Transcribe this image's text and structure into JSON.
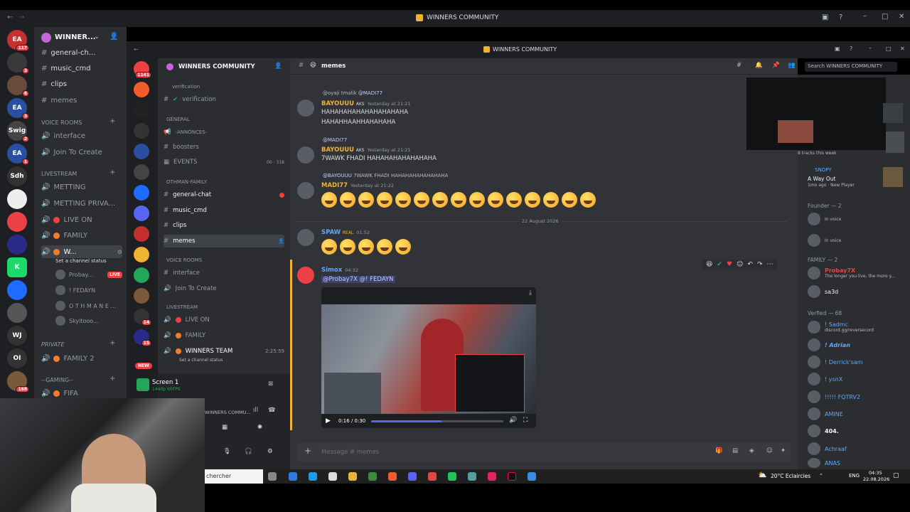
{
  "outer": {
    "title": "WINNERS COMMUNITY",
    "server_name": "WINNER...",
    "servers": [
      {
        "label": "EA",
        "badge": "117"
      },
      {
        "label": "",
        "badge": "3"
      },
      {
        "label": "",
        "badge": "6"
      },
      {
        "label": "EA",
        "badge": "3"
      },
      {
        "label": "Swig",
        "badge": "2"
      },
      {
        "label": "EA",
        "badge": "1"
      },
      {
        "label": "Sdh",
        "badge": ""
      },
      {
        "label": "",
        "badge": ""
      },
      {
        "label": "",
        "badge": ""
      },
      {
        "label": "",
        "badge": ""
      },
      {
        "label": "K",
        "badge": ""
      },
      {
        "label": "",
        "badge": ""
      },
      {
        "label": "",
        "badge": ""
      },
      {
        "label": "WJ",
        "badge": ""
      },
      {
        "label": "OI",
        "badge": ""
      },
      {
        "label": "",
        "badge": "168"
      }
    ],
    "channels_top": [
      "general-ch...",
      "music_cmd",
      "clips",
      "memes"
    ],
    "voice_section": "VOICE ROOMS",
    "voice_channels": [
      "interface",
      "Join To Create"
    ],
    "livestream_section": "LIVESTREAM",
    "live_channels": [
      "METTING",
      "METTING PRIVA...",
      "LIVE ON",
      "FAMILY",
      "W..."
    ],
    "status_hint": "Set a channel status",
    "voice_users": [
      "Probay...",
      "! FEDAYN",
      "O T H M A N E ...",
      "Skyitooo..."
    ],
    "live_badge": "LIVE",
    "private_section": "PRIVATE",
    "private_channels": [
      "FAMILY 2"
    ],
    "gaming_section": "--GAMING--",
    "gaming_channels": [
      "FIFA"
    ]
  },
  "inner": {
    "title": "WINNERS COMMUNITY",
    "server_name": "WINNERS COMMUNITY",
    "verification_section": "verification",
    "verification_channel": "verification",
    "general_section": "GÉNÉRAL",
    "general_channels": [
      "-ANNONCES-",
      "boosters",
      "EVENTS"
    ],
    "events_count": "00 : 318",
    "family_section": "OTHMAN-FAMILY",
    "family_channels": [
      "general-chat",
      "music_cmd",
      "clips",
      "memes"
    ],
    "voice_section": "VOICE ROOMS",
    "voice_channels": [
      "interface",
      "Join To Create"
    ],
    "livestream_section": "LIVESTREAM",
    "live_channels": [
      "LIVE ON",
      "FAMILY",
      "WINNERS TEAM"
    ],
    "live_timer": "2:25:59",
    "status_hint": "Set a channel status",
    "screen_title": "Screen 1",
    "screen_sub": "1440p 60FPS",
    "screen_server": "WINNERS COMMU...",
    "new_badge": "NEW",
    "server_badges": [
      "1141",
      "",
      "",
      "",
      "",
      "",
      "",
      "",
      "",
      "",
      "",
      "",
      "14",
      "15"
    ]
  },
  "chat": {
    "channel": "memes",
    "search_placeholder": "Search WINNERS COMMUNITY",
    "date_divider": "22 August 2026",
    "messages": [
      {
        "reply": "@oyaji tmalik",
        "reply_to": "@MADI77",
        "author": "BAYOUUU",
        "tag": "AKS",
        "time": "Yesterday at 21:21",
        "lines": [
          "HAHAHAHAHAHAHAHAHAHA",
          "HAHAHHAAHHAHAHAHA"
        ]
      },
      {
        "reply": "@MADI77",
        "author": "BAYOUUU",
        "tag": "AKS",
        "time": "Yesterday at 21:21",
        "lines": [
          "7WAWK FHADI HAHAHAHAHAHAHAHA"
        ]
      },
      {
        "reply": "@BAYOUUU",
        "reply_text": "7WAWK FHADI HAHAHAHAHAHAHAHA",
        "author": "MADI77",
        "time": "Yesterday at 21:22",
        "emojis": 15
      },
      {
        "author": "SPAW",
        "tag": "REAL",
        "time": "01:52",
        "emojis": 5
      },
      {
        "author": "Simox",
        "time": "04:32",
        "mentions": "@Probay7X @! FEDAYN",
        "video_time": "0:16 / 0:30",
        "video_progress": 0.53
      }
    ],
    "composer_placeholder": "Message # memes"
  },
  "members": {
    "stream_caption": "8 tracks this week",
    "activity_user": "SNOPY",
    "activity_game": "A Way Out",
    "activity_meta": "1mo ago · New Player",
    "founder_section": "Founder — 2",
    "founder_status": "In voice",
    "family_section": "FAMILY — 2",
    "family": [
      {
        "name": "Probay7X",
        "status": "The longer you live, the more y..."
      },
      {
        "name": "sa3d",
        "status": ""
      }
    ],
    "verified_section": "Verfied — 68",
    "verified": [
      {
        "name": "! Sadmc",
        "status": "discord.gg/reversecord"
      },
      {
        "name": "! Adrian",
        "status": ""
      },
      {
        "name": "! Derrick'sam",
        "status": ""
      },
      {
        "name": "! ysnX",
        "status": ""
      },
      {
        "name": "!!!!! FQTRV2",
        "status": ""
      },
      {
        "name": "AMINE",
        "status": ""
      },
      {
        "name": "404.",
        "status": ""
      },
      {
        "name": "Achraaf",
        "status": ""
      },
      {
        "name": "ANAS",
        "status": ""
      }
    ]
  },
  "taskbar": {
    "search": "chercher",
    "weather": "20°C Eclaircies",
    "lang": "ENG",
    "time": "04:35",
    "date": "22.08.2026"
  },
  "colors": {
    "accent": "#5865f2",
    "live_red": "#ed4245",
    "online_green": "#23a55a",
    "orange": "#f57c2b",
    "gold": "#f0b232"
  }
}
